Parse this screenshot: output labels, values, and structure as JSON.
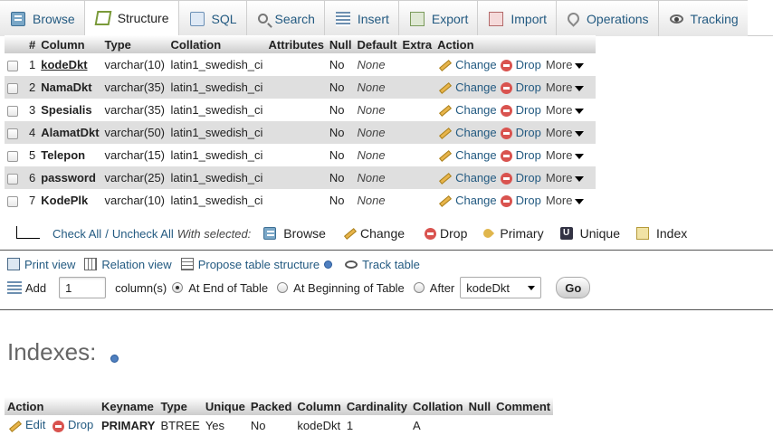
{
  "tabs": [
    {
      "label": "Browse",
      "icon": "browse-icon",
      "active": false
    },
    {
      "label": "Structure",
      "icon": "structure-icon",
      "active": true
    },
    {
      "label": "SQL",
      "icon": "sql-icon",
      "active": false
    },
    {
      "label": "Search",
      "icon": "search-icon",
      "active": false
    },
    {
      "label": "Insert",
      "icon": "insert-icon",
      "active": false
    },
    {
      "label": "Export",
      "icon": "export-icon",
      "active": false
    },
    {
      "label": "Import",
      "icon": "import-icon",
      "active": false
    },
    {
      "label": "Operations",
      "icon": "operations-icon",
      "active": false
    },
    {
      "label": "Tracking",
      "icon": "tracking-icon",
      "active": false
    }
  ],
  "structure": {
    "headers": [
      "#",
      "Column",
      "Type",
      "Collation",
      "Attributes",
      "Null",
      "Default",
      "Extra",
      "Action"
    ],
    "change_label": "Change",
    "drop_label": "Drop",
    "more_label": "More",
    "rows": [
      {
        "num": "1",
        "column": "kodeDkt",
        "type": "varchar(10)",
        "collation": "latin1_swedish_ci",
        "attributes": "",
        "null": "No",
        "default": "None",
        "extra": ""
      },
      {
        "num": "2",
        "column": "NamaDkt",
        "type": "varchar(35)",
        "collation": "latin1_swedish_ci",
        "attributes": "",
        "null": "No",
        "default": "None",
        "extra": ""
      },
      {
        "num": "3",
        "column": "Spesialis",
        "type": "varchar(35)",
        "collation": "latin1_swedish_ci",
        "attributes": "",
        "null": "No",
        "default": "None",
        "extra": ""
      },
      {
        "num": "4",
        "column": "AlamatDkt",
        "type": "varchar(50)",
        "collation": "latin1_swedish_ci",
        "attributes": "",
        "null": "No",
        "default": "None",
        "extra": ""
      },
      {
        "num": "5",
        "column": "Telepon",
        "type": "varchar(15)",
        "collation": "latin1_swedish_ci",
        "attributes": "",
        "null": "No",
        "default": "None",
        "extra": ""
      },
      {
        "num": "6",
        "column": "password",
        "type": "varchar(25)",
        "collation": "latin1_swedish_ci",
        "attributes": "",
        "null": "No",
        "default": "None",
        "extra": ""
      },
      {
        "num": "7",
        "column": "KodePlk",
        "type": "varchar(10)",
        "collation": "latin1_swedish_ci",
        "attributes": "",
        "null": "No",
        "default": "None",
        "extra": ""
      }
    ]
  },
  "checkbar": {
    "check_all": "Check All",
    "separator": "/",
    "uncheck_all": "Uncheck All",
    "with_selected": "With selected:",
    "actions": [
      {
        "label": "Browse",
        "icon": "browse-icon"
      },
      {
        "label": "Change",
        "icon": "pencil-icon"
      },
      {
        "label": "Drop",
        "icon": "drop-icon"
      },
      {
        "label": "Primary",
        "icon": "key-icon"
      },
      {
        "label": "Unique",
        "icon": "unique-icon",
        "glyph": "U"
      },
      {
        "label": "Index",
        "icon": "index-icon"
      }
    ]
  },
  "links": {
    "print_view": "Print view",
    "relation_view": "Relation view",
    "propose": "Propose table structure",
    "track": "Track table"
  },
  "add": {
    "label": "Add",
    "count": "1",
    "columns_label": "column(s)",
    "at_end": "At End of Table",
    "at_beginning": "At Beginning of Table",
    "after": "After",
    "after_value": "kodeDkt",
    "go": "Go",
    "selected_position": "At End of Table"
  },
  "indexes": {
    "title": "Indexes:",
    "headers": [
      "Action",
      "Keyname",
      "Type",
      "Unique",
      "Packed",
      "Column",
      "Cardinality",
      "Collation",
      "Null",
      "Comment"
    ],
    "edit_label": "Edit",
    "drop_label": "Drop",
    "rows": [
      {
        "keyname": "PRIMARY",
        "type": "BTREE",
        "unique": "Yes",
        "packed": "No",
        "column": "kodeDkt",
        "cardinality": "1",
        "collation": "A",
        "null": "",
        "comment": ""
      }
    ]
  },
  "colors": {
    "link": "#235a81",
    "drop": "#d9534f"
  }
}
